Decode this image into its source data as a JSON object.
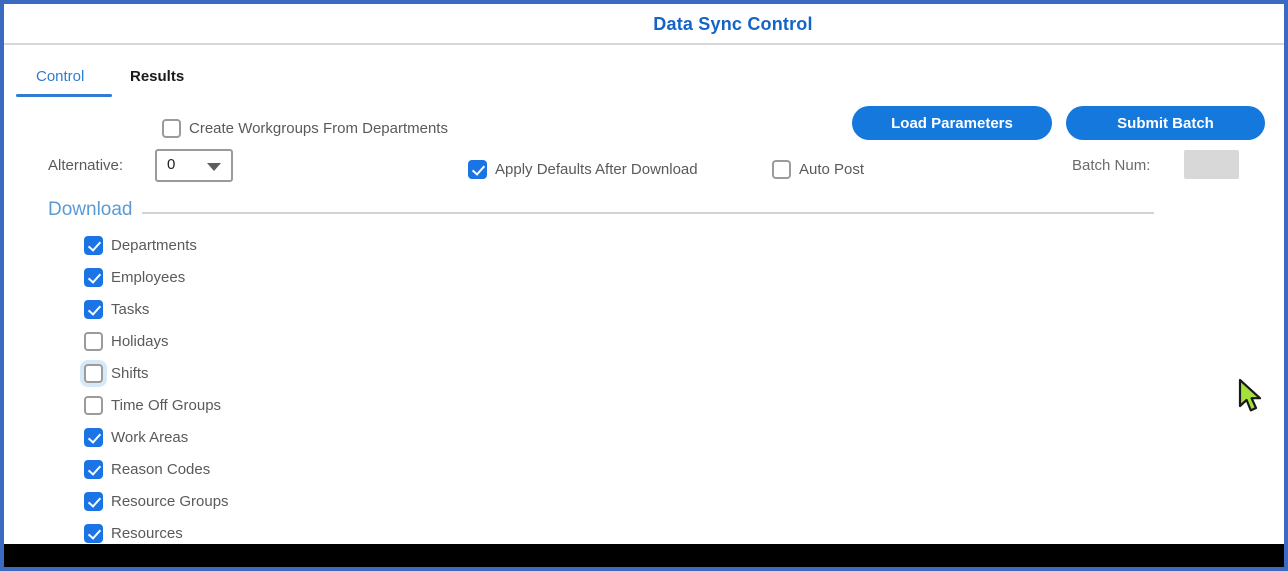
{
  "window": {
    "title": "Data Sync Control"
  },
  "tabs": {
    "control": "Control",
    "results": "Results",
    "active": "Control"
  },
  "buttons": {
    "load_parameters": "Load Parameters",
    "submit_batch": "Submit Batch"
  },
  "controls": {
    "create_workgroups": {
      "label": "Create Workgroups From Departments",
      "checked": false
    },
    "alternative": {
      "label": "Alternative:",
      "value": "0"
    },
    "apply_defaults": {
      "label": "Apply Defaults After Download",
      "checked": true
    },
    "auto_post": {
      "label": "Auto Post",
      "checked": false
    },
    "batch_num": {
      "label": "Batch Num:",
      "value": ""
    }
  },
  "download_section": {
    "title": "Download",
    "items": [
      {
        "label": "Departments",
        "checked": true
      },
      {
        "label": "Employees",
        "checked": true
      },
      {
        "label": "Tasks",
        "checked": true
      },
      {
        "label": "Holidays",
        "checked": false
      },
      {
        "label": "Shifts",
        "checked": false,
        "focused": true
      },
      {
        "label": "Time Off Groups",
        "checked": false
      },
      {
        "label": "Work Areas",
        "checked": true
      },
      {
        "label": "Reason Codes",
        "checked": true
      },
      {
        "label": "Resource Groups",
        "checked": true
      },
      {
        "label": "Resources",
        "checked": true
      }
    ]
  },
  "colors": {
    "accent_button": "#1478dc",
    "checkbox_checked": "#1b74e4",
    "title_text": "#1464c8",
    "section_title": "#5b9bd5",
    "window_border": "#3a6bc0",
    "cursor_fill": "#a4e13c"
  }
}
